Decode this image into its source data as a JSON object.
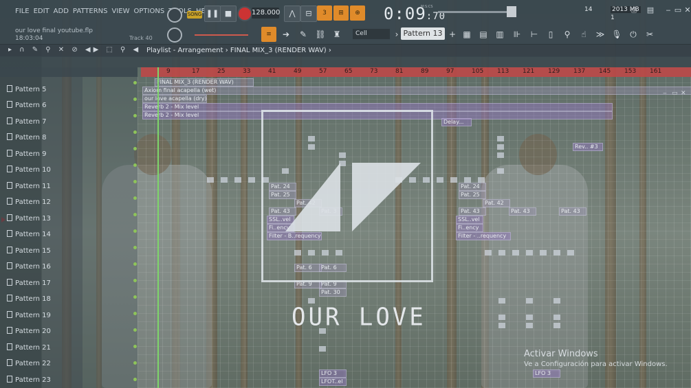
{
  "menu": [
    "FILE",
    "EDIT",
    "ADD",
    "PATTERNS",
    "VIEW",
    "OPTIONS",
    "TOOLS",
    "HELP"
  ],
  "project": {
    "name": "our love final youtube.flp",
    "time": "18:03:04",
    "track": "Track 40"
  },
  "transport": {
    "mode": "SONG",
    "bpm": "128.000",
    "time_main": "0:09",
    "time_sub": "70",
    "time_unit": "M:S:CS",
    "cpu": "14",
    "memory": "2013 MB",
    "voices": "1"
  },
  "tools": {
    "snap": "Cell",
    "pattern": "Pattern 13"
  },
  "playlist": {
    "breadcrumb_root": "Playlist - Arrangement",
    "breadcrumb_sep": "›",
    "breadcrumb_item": "FINAL MIX_3 (RENDER WAV)",
    "ruler": [
      "9",
      "17",
      "25",
      "33",
      "41",
      "49",
      "57",
      "65",
      "73",
      "81",
      "89",
      "97",
      "105",
      "113",
      "121",
      "129",
      "137",
      "145",
      "153",
      "161"
    ]
  },
  "patterns": [
    "Pattern 5",
    "Pattern 6",
    "Pattern 7",
    "Pattern 8",
    "Pattern 9",
    "Pattern 10",
    "Pattern 11",
    "Pattern 12",
    "Pattern 13",
    "Pattern 14",
    "Pattern 15",
    "Pattern 16",
    "Pattern 17",
    "Pattern 18",
    "Pattern 19",
    "Pattern 20",
    "Pattern 21",
    "Pattern 22",
    "Pattern 23"
  ],
  "clips": [
    {
      "label": "FINAL MIX_3 (RENDER WAV)"
    },
    {
      "label": "Axiom final acapella (wet)"
    },
    {
      "label": "our love acapella (dry)"
    },
    {
      "label": "Reverb 2 - Mix level"
    },
    {
      "label": "Reverb 2 - Mix level"
    },
    {
      "label": "Delay..."
    },
    {
      "label": "Rev.. #3"
    },
    {
      "label": "Pat. 24"
    },
    {
      "label": "Pat. 25"
    },
    {
      "label": "Pat. 42"
    },
    {
      "label": "Pat. 43"
    },
    {
      "label": "Pat. 3"
    },
    {
      "label": "SSL..vel"
    },
    {
      "label": "Fi..ency"
    },
    {
      "label": "Filter - B..requency"
    },
    {
      "label": "Pat. 24"
    },
    {
      "label": "Pat. 25"
    },
    {
      "label": "Pat. 42"
    },
    {
      "label": "Pat. 43"
    },
    {
      "label": "Pat. 43"
    },
    {
      "label": "Pat. 43"
    },
    {
      "label": "SSL..vel"
    },
    {
      "label": "Fi..ency"
    },
    {
      "label": "Filter - ..requency"
    },
    {
      "label": "Pat. 6"
    },
    {
      "label": "Pat. 6"
    },
    {
      "label": "Pat. 9"
    },
    {
      "label": "Pat. 9"
    },
    {
      "label": "Pat. 30"
    },
    {
      "label": "LFO 3"
    },
    {
      "label": "LFO 3"
    },
    {
      "label": "LFOT..el"
    }
  ],
  "overlay": {
    "title": "OUR LOVE"
  },
  "activation": {
    "title": "Activar Windows",
    "subtitle": "Ve a Configuración para activar Windows."
  }
}
